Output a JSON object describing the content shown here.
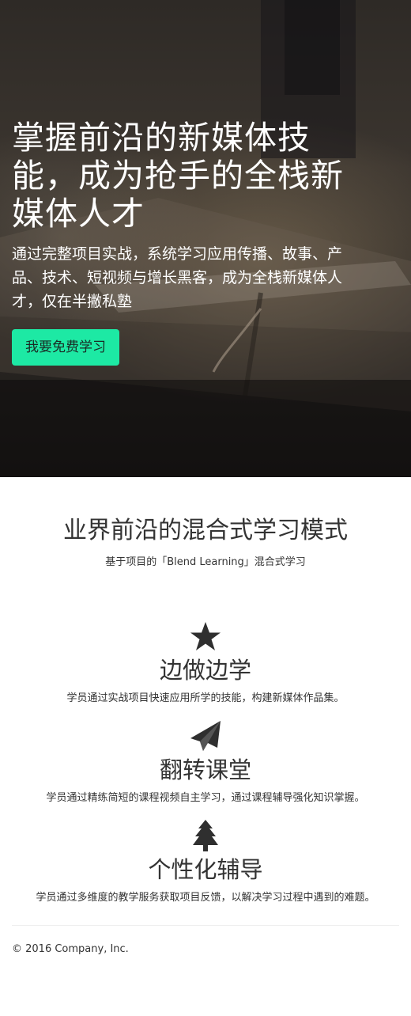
{
  "hero": {
    "title_lines": [
      "掌握前沿的新媒体技",
      "能，成为抢手的全栈新",
      "媒体人才"
    ],
    "subtitle_lines": [
      "通过完整项目实战，系统学习应用传播、故事、产",
      "品、技术、短视频与增长黑客，成为全栈新媒体人",
      "才，仅在半撇私塾"
    ],
    "cta_label": "我要免费学习",
    "cta_color": "#1de9a4"
  },
  "intro": {
    "title": "业界前沿的混合式学习模式",
    "subtitle": "基于项目的「Blend Learning」混合式学习"
  },
  "features": [
    {
      "icon": "star-icon",
      "title": "边做边学",
      "desc": "学员通过实战项目快速应用所学的技能，构建新媒体作品集。"
    },
    {
      "icon": "paper-plane-icon",
      "title": "翻转课堂",
      "desc": "学员通过精练简短的课程视频自主学习，通过课程辅导强化知识掌握。"
    },
    {
      "icon": "tree-icon",
      "title": "个性化辅导",
      "desc": "学员通过多维度的教学服务获取项目反馈，以解决学习过程中遇到的难题。"
    }
  ],
  "footer": {
    "copyright": "© 2016 Company, Inc."
  }
}
